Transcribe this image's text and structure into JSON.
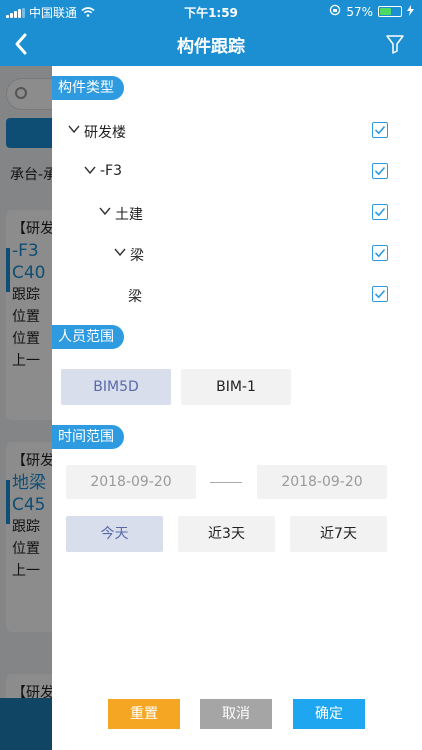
{
  "status_bar": {
    "carrier": "中国联通",
    "time": "下午1:59",
    "battery": "57%",
    "battery_level": 0.57
  },
  "nav": {
    "title": "构件跟踪"
  },
  "background": {
    "filter_text": "承台-承",
    "cards": [
      {
        "header": "【研发",
        "title1": "-F3",
        "title2": "C40",
        "lines": [
          "跟踪",
          "位置",
          "位置",
          "上一"
        ]
      },
      {
        "header": "【研发",
        "title1": "地梁",
        "title2": "C45",
        "lines": [
          "跟踪",
          "位置",
          "上一"
        ]
      },
      {
        "header": "【研发"
      }
    ]
  },
  "drawer": {
    "component_type": {
      "label": "构件类型",
      "tree": [
        {
          "label": "研发楼",
          "level": 0,
          "expanded": true,
          "checked": true
        },
        {
          "label": "-F3",
          "level": 1,
          "expanded": true,
          "checked": true
        },
        {
          "label": "土建",
          "level": 2,
          "expanded": true,
          "checked": true
        },
        {
          "label": "梁",
          "level": 3,
          "expanded": true,
          "checked": true
        },
        {
          "label": "梁",
          "level": 4,
          "expanded": false,
          "checked": true
        }
      ]
    },
    "person_range": {
      "label": "人员范围",
      "options": [
        {
          "label": "BIM5D",
          "selected": true
        },
        {
          "label": "BIM-1",
          "selected": false
        }
      ]
    },
    "time_range": {
      "label": "时间范围",
      "start_date": "2018-09-20",
      "end_date": "2018-09-20",
      "quick": [
        {
          "label": "今天",
          "selected": true
        },
        {
          "label": "近3天",
          "selected": false
        },
        {
          "label": "近7天",
          "selected": false
        }
      ]
    },
    "buttons": {
      "reset": {
        "label": "重置",
        "color": "#f5a623"
      },
      "cancel": {
        "label": "取消",
        "color": "#a5a5a5"
      },
      "confirm": {
        "label": "确定",
        "color": "#1ea7f0"
      }
    }
  },
  "colors": {
    "primary": "#1c8fd3",
    "tag": "#2e9be0"
  }
}
